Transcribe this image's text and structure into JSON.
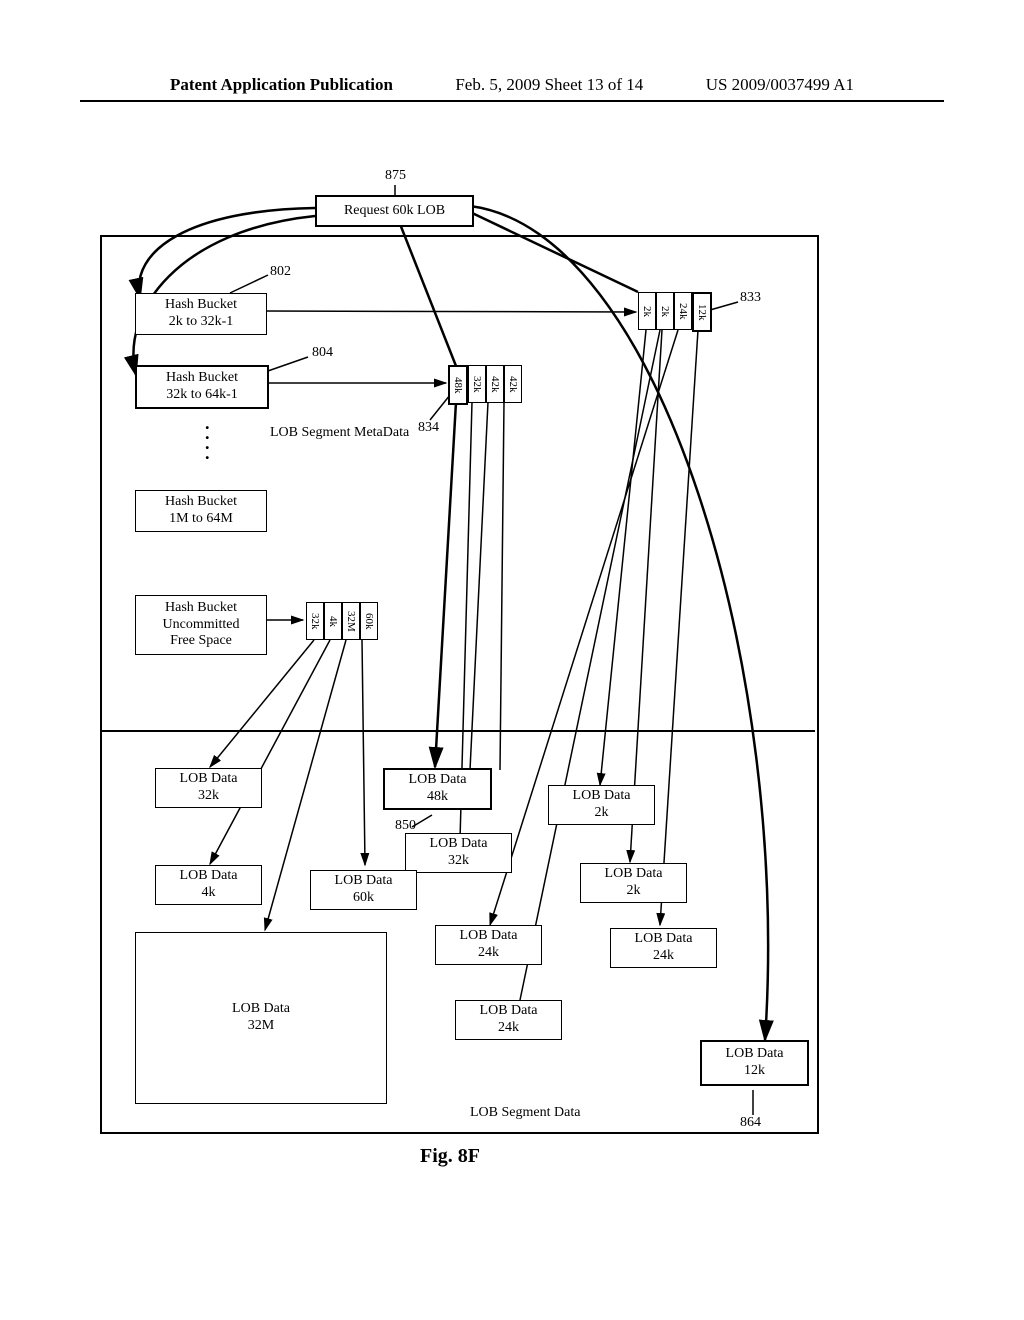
{
  "header": {
    "left": "Patent Application Publication",
    "center": "Feb. 5, 2009  Sheet 13 of 14",
    "right": "US 2009/0037499 A1"
  },
  "refs": {
    "r875": "875",
    "r802": "802",
    "r804": "804",
    "r833": "833",
    "r834": "834",
    "r850": "850",
    "r864": "864"
  },
  "boxes": {
    "request": "Request 60k LOB",
    "hb1a": "Hash Bucket",
    "hb1b": "2k to 32k-1",
    "hb2a": "Hash Bucket",
    "hb2b": "32k to 64k-1",
    "hb3a": "Hash Bucket",
    "hb3b": "1M to 64M",
    "hb4a": "Hash Bucket",
    "hb4b": "Uncommitted",
    "hb4c": "Free Space",
    "lob32k": "LOB Data\n32k",
    "lob48k": "LOB Data\n48k",
    "lob2ka": "LOB Data\n2k",
    "lob4k": "LOB Data\n4k",
    "lob60k": "LOB Data\n60k",
    "lob32kb": "LOB Data\n32k",
    "lob2kb": "LOB Data\n2k",
    "lob24ka": "LOB Data\n24k",
    "lob24kb": "LOB Data\n24k",
    "lob32m": "LOB Data\n32M",
    "lob24kc": "LOB Data\n24k",
    "lob12k": "LOB Data\n12k"
  },
  "labels": {
    "metadata": "LOB Segment MetaData",
    "segdata": "LOB Segment Data"
  },
  "chipsets": {
    "set833": [
      "2k",
      "2k",
      "24k",
      "12k"
    ],
    "set834": [
      "48k",
      "32k",
      "42k",
      "42k"
    ],
    "setUnc": [
      "32k",
      "4k",
      "32M",
      "60k"
    ]
  },
  "caption": "Fig. 8F"
}
